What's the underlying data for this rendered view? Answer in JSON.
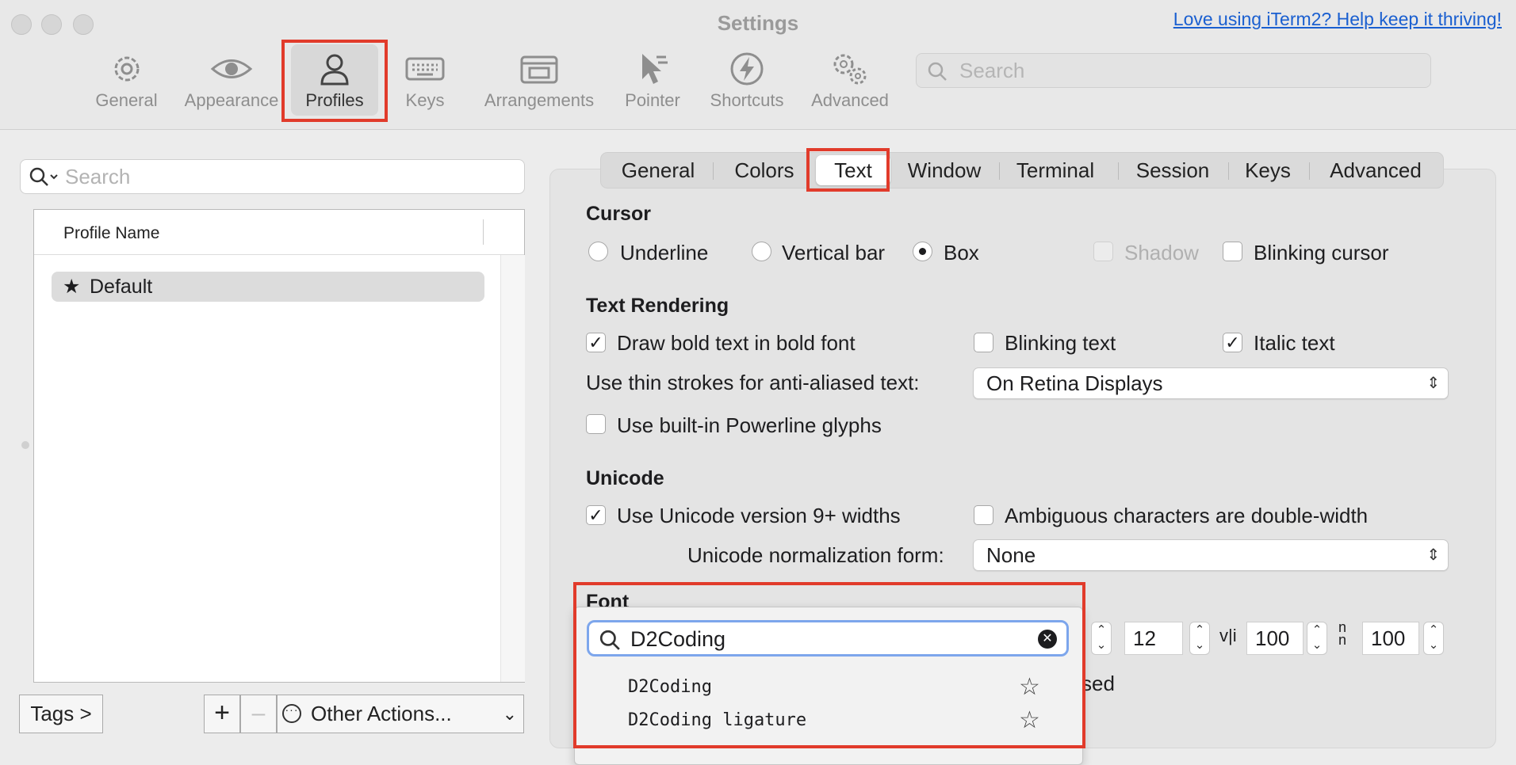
{
  "window": {
    "title": "Settings",
    "promo_link": "Love using iTerm2? Help keep it thriving!"
  },
  "toolbar": {
    "items": [
      {
        "label": "General",
        "icon": "gear-icon"
      },
      {
        "label": "Appearance",
        "icon": "eye-icon"
      },
      {
        "label": "Profiles",
        "icon": "person-icon"
      },
      {
        "label": "Keys",
        "icon": "keyboard-icon"
      },
      {
        "label": "Arrangements",
        "icon": "windows-icon"
      },
      {
        "label": "Pointer",
        "icon": "pointer-icon"
      },
      {
        "label": "Shortcuts",
        "icon": "bolt-icon"
      },
      {
        "label": "Advanced",
        "icon": "gears-icon"
      }
    ],
    "selected": "Profiles",
    "search_placeholder": "Search"
  },
  "profiles_panel": {
    "search_placeholder": "Search",
    "column_header": "Profile Name",
    "rows": [
      {
        "name": "Default",
        "icon": "star-icon"
      }
    ],
    "tags_button": "Tags >",
    "add_button": "+",
    "remove_button": "–",
    "other_actions_button": "Other Actions..."
  },
  "tabs": {
    "items": [
      "General",
      "Colors",
      "Text",
      "Window",
      "Terminal",
      "Session",
      "Keys",
      "Advanced"
    ],
    "selected": "Text"
  },
  "cursor": {
    "heading": "Cursor",
    "underline": "Underline",
    "vertical_bar": "Vertical bar",
    "box": "Box",
    "selected": "Box",
    "shadow": "Shadow",
    "blinking_cursor": "Blinking cursor"
  },
  "text_rendering": {
    "heading": "Text Rendering",
    "bold": "Draw bold text in bold font",
    "bold_checked": true,
    "blinking_text": "Blinking text",
    "blinking_checked": false,
    "italic": "Italic text",
    "italic_checked": true,
    "thin_strokes_label": "Use thin strokes for anti-aliased text:",
    "thin_strokes_value": "On Retina Displays",
    "powerline": "Use built-in Powerline glyphs",
    "powerline_checked": false
  },
  "unicode": {
    "heading": "Unicode",
    "widths": "Use Unicode version 9+ widths",
    "widths_checked": true,
    "ambiguous": "Ambiguous characters are double-width",
    "ambiguous_checked": false,
    "normalization_label": "Unicode normalization form:",
    "normalization_value": "None"
  },
  "font": {
    "heading": "Font",
    "size": "12",
    "horizontal_spacing": "100",
    "vertical_spacing": "100",
    "partial_label_tail": "sed",
    "search_value": "D2Coding",
    "results": [
      "D2Coding",
      "D2Coding ligature"
    ]
  },
  "colors": {
    "highlight_red": "#e13b2b",
    "link_blue": "#1a5fd0",
    "focus_ring": "#7da6ec"
  }
}
